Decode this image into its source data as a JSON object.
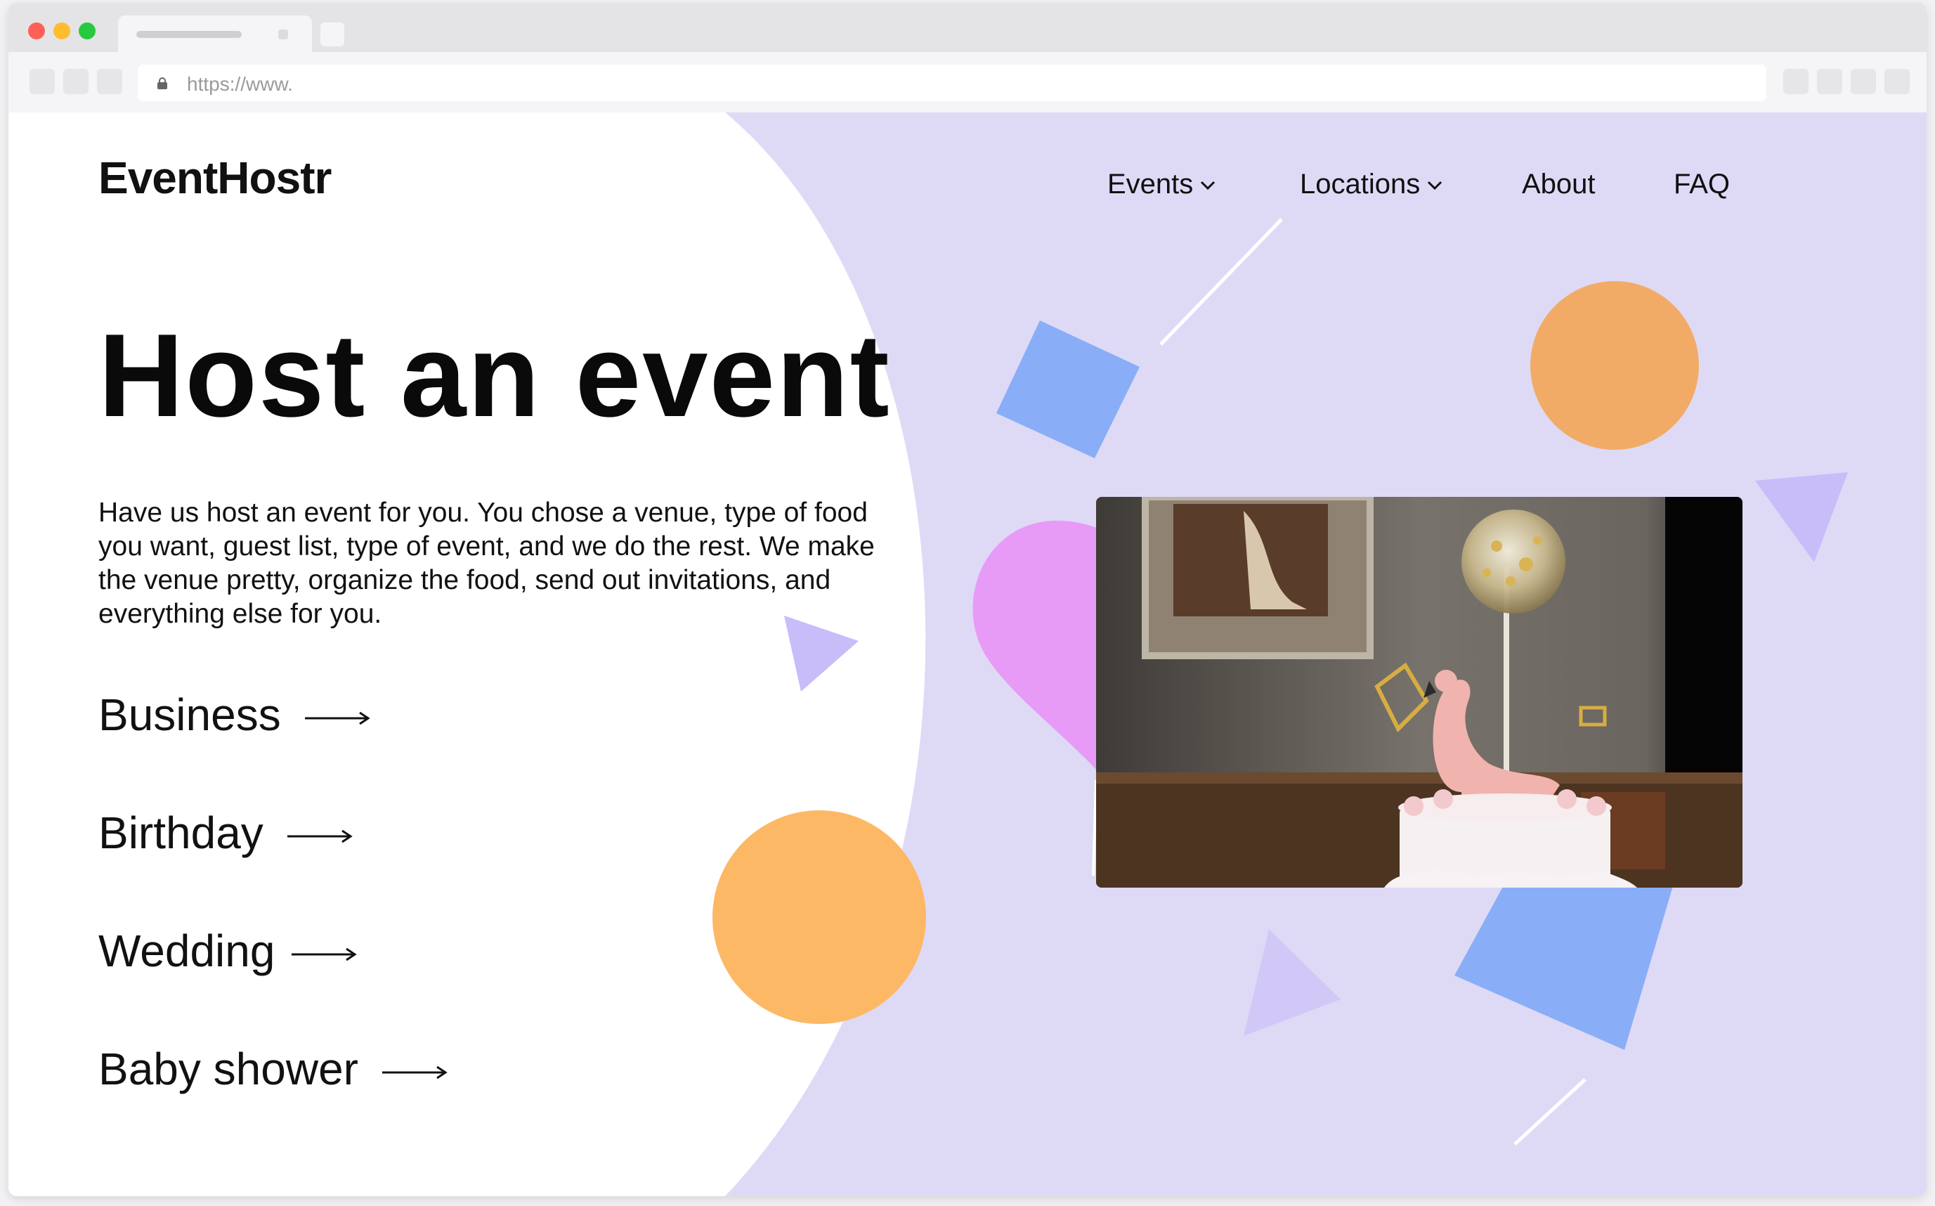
{
  "browser": {
    "url": "https://www."
  },
  "site": {
    "logo": "EventHostr",
    "nav": [
      {
        "label": "Events",
        "dropdown": true
      },
      {
        "label": "Locations",
        "dropdown": true
      },
      {
        "label": "About",
        "dropdown": false
      },
      {
        "label": "FAQ",
        "dropdown": false
      }
    ]
  },
  "hero": {
    "headline": "Host an event",
    "description": "Have us host an event for you. You chose a venue, type of food you want, guest list, type of event, and we do the rest. We make the venue pretty, organize the food, send out invitations, and everything else for you.",
    "categories": [
      "Business",
      "Birthday",
      "Wedding",
      "Baby shower"
    ],
    "image_subject": "pink flamingo cake with gold confetti balloon"
  },
  "colors": {
    "lavender_bg": "#dedaf6",
    "blue_shape": "#89aef7",
    "orange_shape": "#fdb865",
    "orange_circle_right": "#f2ab66",
    "pink_shape": "#e89af7",
    "violet_triangle": "#c8bcf9",
    "text": "#111111"
  },
  "icons": [
    "lock-icon",
    "chevron-down-icon",
    "arrow-right-icon"
  ]
}
